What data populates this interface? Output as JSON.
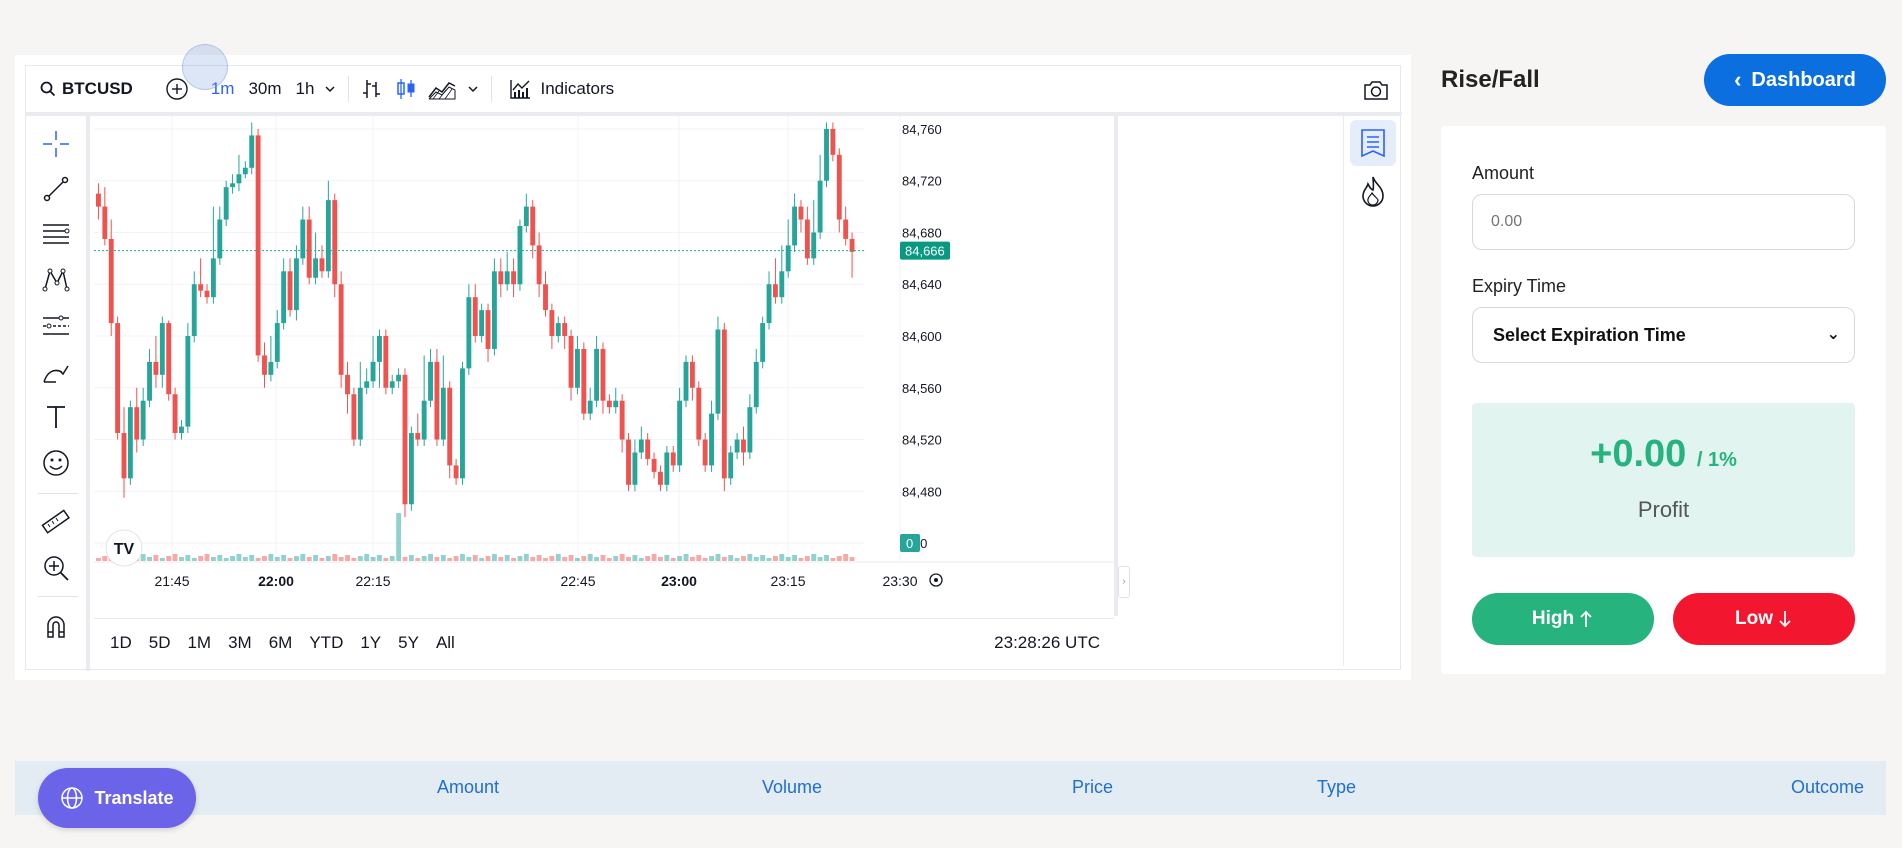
{
  "chart_toolbar": {
    "symbol": "BTCUSD",
    "intervals": [
      "1m",
      "30m",
      "1h"
    ],
    "active_interval": "1m",
    "indicators_label": "Indicators"
  },
  "chart": {
    "price_ticks": [
      "84,760",
      "84,720",
      "84,680",
      "84,640",
      "84,600",
      "84,560",
      "84,520",
      "84,480",
      ",440"
    ],
    "time_ticks": [
      {
        "label": "21:45",
        "bold": false
      },
      {
        "label": "22:00",
        "bold": true
      },
      {
        "label": "22:15",
        "bold": false
      },
      {
        "label": "22:45",
        "bold": false
      },
      {
        "label": "23:00",
        "bold": true
      },
      {
        "label": "23:15",
        "bold": false
      },
      {
        "label": "23:30",
        "bold": false
      }
    ],
    "last_price_label": "84,666",
    "volume_label": "0",
    "logo_text": "TV"
  },
  "chart_data": {
    "type": "candlestick",
    "ylim": [
      84430,
      84770
    ],
    "last_price": 84666,
    "candles": [
      [
        84710,
        84700,
        84718,
        84690
      ],
      [
        84700,
        84675,
        84715,
        84670
      ],
      [
        84675,
        84610,
        84690,
        84600
      ],
      [
        84610,
        84525,
        84615,
        84520
      ],
      [
        84525,
        84490,
        84545,
        84475
      ],
      [
        84490,
        84545,
        84550,
        84485
      ],
      [
        84545,
        84520,
        84560,
        84510
      ],
      [
        84520,
        84550,
        84560,
        84515
      ],
      [
        84550,
        84580,
        84590,
        84545
      ],
      [
        84580,
        84570,
        84600,
        84560
      ],
      [
        84570,
        84610,
        84615,
        84560
      ],
      [
        84610,
        84555,
        84612,
        84550
      ],
      [
        84555,
        84525,
        84560,
        84520
      ],
      [
        84525,
        84530,
        84535,
        84520
      ],
      [
        84530,
        84600,
        84610,
        84525
      ],
      [
        84600,
        84640,
        84650,
        84595
      ],
      [
        84640,
        84635,
        84660,
        84630
      ],
      [
        84635,
        84630,
        84640,
        84625
      ],
      [
        84630,
        84660,
        84700,
        84625
      ],
      [
        84660,
        84690,
        84700,
        84655
      ],
      [
        84690,
        84715,
        84720,
        84685
      ],
      [
        84715,
        84718,
        84725,
        84710
      ],
      [
        84718,
        84725,
        84740,
        84712
      ],
      [
        84725,
        84730,
        84735,
        84722
      ],
      [
        84730,
        84755,
        84765,
        84725
      ],
      [
        84755,
        84585,
        84760,
        84580
      ],
      [
        84585,
        84570,
        84595,
        84560
      ],
      [
        84570,
        84580,
        84600,
        84565
      ],
      [
        84580,
        84610,
        84620,
        84575
      ],
      [
        84610,
        84650,
        84660,
        84605
      ],
      [
        84650,
        84620,
        84660,
        84615
      ],
      [
        84620,
        84660,
        84670,
        84612
      ],
      [
        84660,
        84690,
        84700,
        84655
      ],
      [
        84690,
        84645,
        84700,
        84640
      ],
      [
        84645,
        84660,
        84680,
        84640
      ],
      [
        84660,
        84650,
        84670,
        84645
      ],
      [
        84650,
        84705,
        84720,
        84645
      ],
      [
        84705,
        84640,
        84710,
        84630
      ],
      [
        84640,
        84570,
        84650,
        84560
      ],
      [
        84570,
        84555,
        84580,
        84540
      ],
      [
        84555,
        84520,
        84560,
        84515
      ],
      [
        84520,
        84560,
        84580,
        84515
      ],
      [
        84560,
        84565,
        84575,
        84555
      ],
      [
        84565,
        84580,
        84600,
        84560
      ],
      [
        84580,
        84600,
        84605,
        84560
      ],
      [
        84600,
        84560,
        84605,
        84555
      ],
      [
        84560,
        84565,
        84570,
        84555
      ],
      [
        84565,
        84570,
        84575,
        84560
      ],
      [
        84570,
        84470,
        84575,
        84460
      ],
      [
        84470,
        84525,
        84530,
        84465
      ],
      [
        84525,
        84520,
        84540,
        84515
      ],
      [
        84520,
        84550,
        84585,
        84515
      ],
      [
        84550,
        84580,
        84590,
        84545
      ],
      [
        84580,
        84520,
        84590,
        84515
      ],
      [
        84520,
        84560,
        84585,
        84515
      ],
      [
        84560,
        84500,
        84565,
        84490
      ],
      [
        84500,
        84490,
        84505,
        84485
      ],
      [
        84490,
        84575,
        84580,
        84485
      ],
      [
        84575,
        84630,
        84640,
        84570
      ],
      [
        84630,
        84600,
        84640,
        84595
      ],
      [
        84600,
        84620,
        84625,
        84595
      ],
      [
        84620,
        84590,
        84625,
        84580
      ],
      [
        84590,
        84650,
        84660,
        84585
      ],
      [
        84650,
        84640,
        84660,
        84630
      ],
      [
        84640,
        84650,
        84665,
        84635
      ],
      [
        84650,
        84640,
        84660,
        84630
      ],
      [
        84640,
        84685,
        84690,
        84635
      ],
      [
        84685,
        84700,
        84710,
        84680
      ],
      [
        84700,
        84670,
        84705,
        84660
      ],
      [
        84670,
        84640,
        84680,
        84630
      ],
      [
        84640,
        84620,
        84650,
        84615
      ],
      [
        84620,
        84600,
        84625,
        84590
      ],
      [
        84600,
        84610,
        84615,
        84595
      ],
      [
        84610,
        84600,
        84615,
        84590
      ],
      [
        84600,
        84560,
        84605,
        84550
      ],
      [
        84560,
        84590,
        84600,
        84555
      ],
      [
        84590,
        84540,
        84595,
        84535
      ],
      [
        84540,
        84550,
        84560,
        84535
      ],
      [
        84550,
        84590,
        84600,
        84545
      ],
      [
        84590,
        84550,
        84595,
        84540
      ],
      [
        84550,
        84545,
        84555,
        84540
      ],
      [
        84545,
        84550,
        84560,
        84540
      ],
      [
        84550,
        84520,
        84555,
        84510
      ],
      [
        84520,
        84485,
        84525,
        84480
      ],
      [
        84485,
        84510,
        84520,
        84480
      ],
      [
        84510,
        84520,
        84530,
        84505
      ],
      [
        84520,
        84505,
        84525,
        84500
      ],
      [
        84505,
        84495,
        84510,
        84490
      ],
      [
        84495,
        84485,
        84500,
        84480
      ],
      [
        84485,
        84510,
        84515,
        84480
      ],
      [
        84510,
        84500,
        84515,
        84495
      ],
      [
        84500,
        84550,
        84560,
        84495
      ],
      [
        84550,
        84580,
        84585,
        84545
      ],
      [
        84580,
        84560,
        84585,
        84550
      ],
      [
        84560,
        84520,
        84565,
        84515
      ],
      [
        84520,
        84500,
        84525,
        84495
      ],
      [
        84500,
        84540,
        84550,
        84495
      ],
      [
        84540,
        84605,
        84615,
        84535
      ],
      [
        84605,
        84490,
        84610,
        84480
      ],
      [
        84490,
        84510,
        84515,
        84485
      ],
      [
        84510,
        84520,
        84525,
        84505
      ],
      [
        84520,
        84510,
        84530,
        84500
      ],
      [
        84510,
        84545,
        84555,
        84505
      ],
      [
        84545,
        84580,
        84590,
        84540
      ],
      [
        84580,
        84610,
        84615,
        84575
      ],
      [
        84610,
        84640,
        84650,
        84605
      ],
      [
        84640,
        84630,
        84660,
        84625
      ],
      [
        84630,
        84650,
        84670,
        84625
      ],
      [
        84650,
        84670,
        84690,
        84645
      ],
      [
        84670,
        84700,
        84710,
        84665
      ],
      [
        84700,
        84690,
        84705,
        84680
      ],
      [
        84690,
        84660,
        84700,
        84655
      ],
      [
        84660,
        84680,
        84705,
        84655
      ],
      [
        84680,
        84720,
        84740,
        84675
      ],
      [
        84720,
        84760,
        84765,
        84715
      ],
      [
        84760,
        84740,
        84765,
        84735
      ],
      [
        84740,
        84690,
        84745,
        84680
      ],
      [
        84690,
        84675,
        84700,
        84670
      ],
      [
        84675,
        84665,
        84680,
        84645
      ]
    ]
  },
  "range_buttons": [
    "1D",
    "5D",
    "1M",
    "3M",
    "6M",
    "YTD",
    "1Y",
    "5Y",
    "All"
  ],
  "clock": "23:28:26 UTC",
  "trade_panel": {
    "title": "Rise/Fall",
    "dashboard_label": "Dashboard",
    "amount_label": "Amount",
    "amount_placeholder": "0.00",
    "expiry_label": "Expiry Time",
    "expiry_value": "Select Expiration Time",
    "profit_value": "+0.00",
    "profit_pct": "/ 1%",
    "profit_label": "Profit",
    "high_label": "High",
    "low_label": "Low"
  },
  "history": {
    "columns": [
      "Amount",
      "Volume",
      "Price",
      "Type",
      "Outcome"
    ]
  },
  "translate_label": "Translate",
  "colors": {
    "up": "#26a69a",
    "down": "#ef5350",
    "accent": "#2962ff",
    "dashboard": "#0b6fe0",
    "high": "#26b37d",
    "low": "#f2172e",
    "translate": "#6b63e8"
  }
}
